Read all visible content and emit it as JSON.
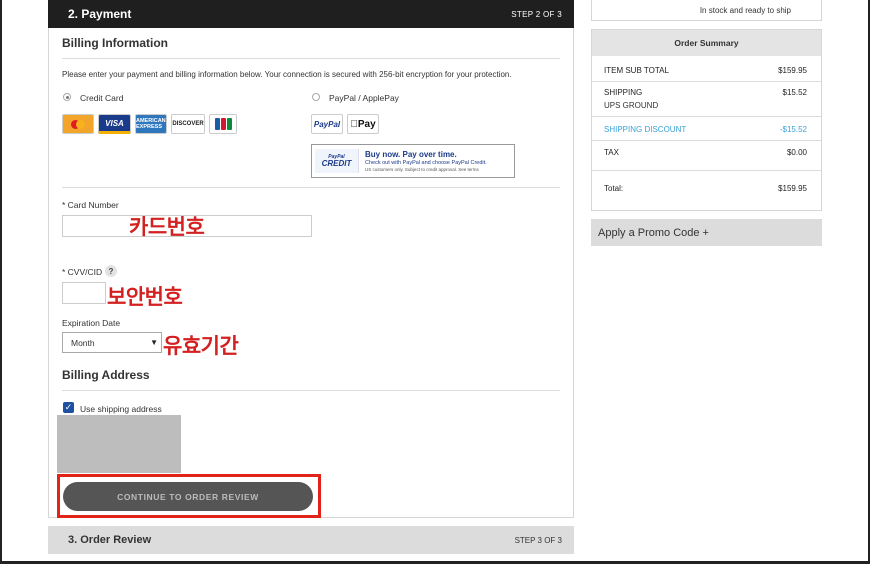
{
  "payment": {
    "header_title": "2. Payment",
    "header_step": "STEP 2 OF 3",
    "billing_info_title": "Billing Information",
    "intro": "Please enter your payment and billing information below. Your connection is secured with 256-bit encryption for your protection.",
    "methods": {
      "credit_card_label": "Credit Card",
      "paypal_label": "PayPal / ApplePay",
      "selected": "credit_card"
    },
    "cards": [
      {
        "name": "mastercard-icon",
        "label": "MasterCard"
      },
      {
        "name": "visa-icon",
        "label": "VISA"
      },
      {
        "name": "amex-icon",
        "label": "AMERICAN EXPRESS"
      },
      {
        "name": "discover-icon",
        "label": "DISCOVER"
      },
      {
        "name": "jcb-icon",
        "label": ""
      }
    ],
    "paypal_button": "PayPal",
    "applepay_button": "Pay",
    "paypal_credit": {
      "logo_top": "PayPal",
      "logo_bottom": "CREDIT",
      "line1": "Buy now. Pay over time.",
      "line2": "Check out with PayPal and choose PayPal Credit.",
      "line3": "US customers only. Subject to credit approval. See terms"
    },
    "card_number_label": "* Card Number",
    "card_number_value": "",
    "card_number_annotation": "카드번호",
    "cvv_label": "* CVV/CID",
    "cvv_help": "?",
    "cvv_value": "",
    "cvv_annotation": "보안번호",
    "expiration_label": "Expiration Date",
    "month_select": "Month",
    "expiration_annotation": "유효기간",
    "billing_address_title": "Billing Address",
    "use_shipping_label": "Use shipping address",
    "use_shipping_checked": true,
    "continue_button": "CONTINUE TO ORDER REVIEW"
  },
  "review": {
    "header_title": "3. Order Review",
    "header_step": "STEP 3 OF 3"
  },
  "sidebar": {
    "stock_text": "In stock and ready to ship",
    "summary_title": "Order Summary",
    "rows": {
      "subtotal_label": "ITEM SUB TOTAL",
      "subtotal_value": "$159.95",
      "shipping_label": "SHIPPING",
      "shipping_sub": "UPS GROUND",
      "shipping_value": "$15.52",
      "discount_label": "SHIPPING DISCOUNT",
      "discount_value": "-$15.52",
      "tax_label": "TAX",
      "tax_value": "$0.00",
      "total_label": "Total:",
      "total_value": "$159.95"
    },
    "promo_label": "Apply a Promo Code +"
  },
  "colors": {
    "header_dark": "#1f1f1f",
    "annotation_red": "#d32020",
    "highlight_red": "#e2231a",
    "discount_blue": "#3aa0d8",
    "button_gray": "#555555"
  }
}
